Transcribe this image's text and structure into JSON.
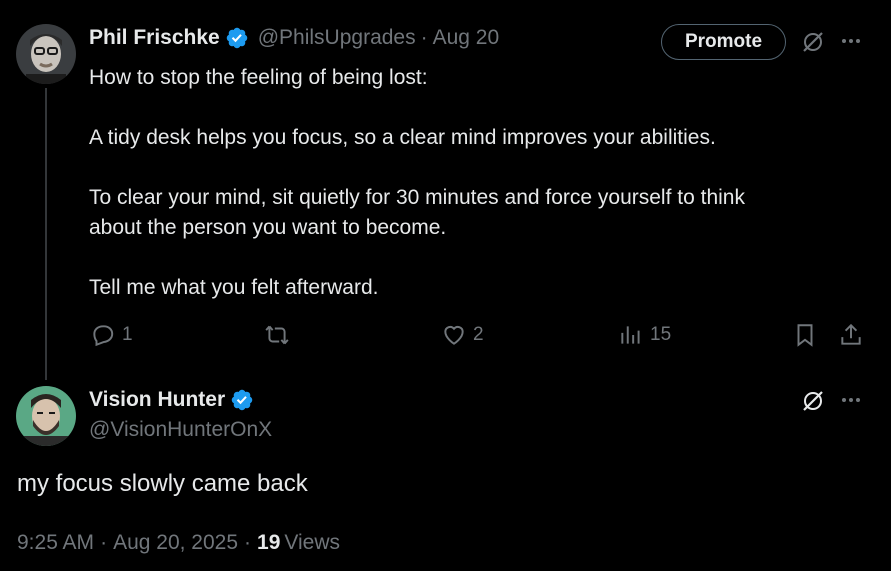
{
  "post": {
    "author_name": "Phil Frischke",
    "handle": "@PhilsUpgrades",
    "separator": "·",
    "date": "Aug 20",
    "promote_label": "Promote",
    "text": "How to stop the feeling of being lost:\n\nA tidy desk helps you focus, so a clear mind improves your abilities.\n\nTo clear your mind, sit quietly for 30 minutes and force yourself to think\nabout the person you want to become.\n\nTell me what you felt afterward.",
    "replies": "1",
    "reposts": "",
    "likes": "2",
    "views": "15"
  },
  "reply": {
    "author_name": "Vision Hunter",
    "handle": "@VisionHunterOnX",
    "text": "my focus slowly came back",
    "time": "9:25 AM",
    "dot1": "·",
    "date": "Aug 20, 2025",
    "dot2": "·",
    "views_count": "19",
    "views_label": "Views"
  },
  "colors": {
    "background": "#000000",
    "text": "#e7e9ea",
    "muted": "#71767b",
    "verified": "#1d9bf0",
    "thread_line": "#333639"
  },
  "icons": [
    "verified-badge-icon",
    "grok-icon",
    "more-icon",
    "reply-icon",
    "repost-icon",
    "like-icon",
    "views-icon",
    "bookmark-icon",
    "share-icon"
  ]
}
